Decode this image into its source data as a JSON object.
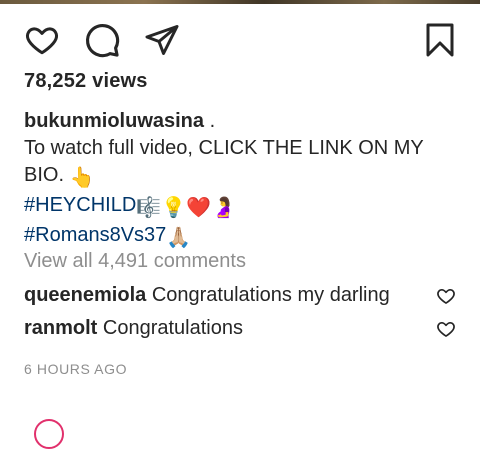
{
  "post": {
    "views": "78,252 views",
    "caption_user": "bukunmioluwasina",
    "caption_suffix": " .",
    "caption_line1": "To watch full video, CLICK THE LINK ON MY BIO. ",
    "caption_emoji1": "👆",
    "hashtag1": "#HEYCHILD",
    "hashtag1_emojis": "🎼💡❤️🤰",
    "hashtag2": "#Romans8Vs37",
    "hashtag2_emojis": "🙏🏼",
    "view_comments": "View all 4,491 comments",
    "comments": [
      {
        "user": "queenemiola",
        "text": "Congratulations my darling"
      },
      {
        "user": "ranmolt",
        "text": "Congratulations"
      }
    ],
    "timestamp": "6 HOURS AGO"
  },
  "icons": {
    "like": "heart-outline-icon",
    "comment": "comment-bubble-icon",
    "share": "paper-plane-icon",
    "save": "bookmark-icon"
  },
  "colors": {
    "text": "#262626",
    "muted": "#8e8e8e",
    "hashtag": "#003569"
  }
}
